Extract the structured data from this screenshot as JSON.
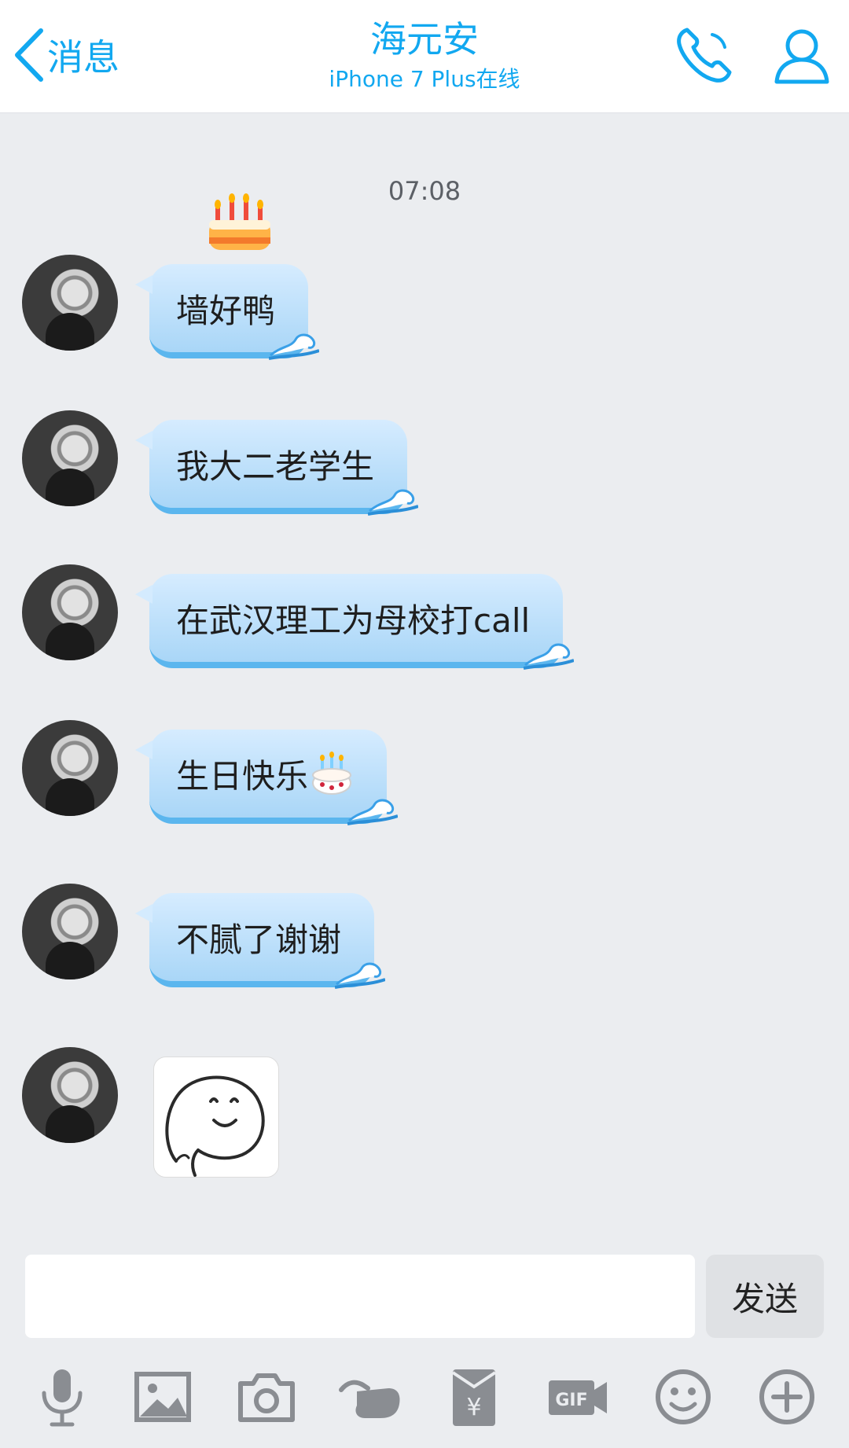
{
  "header": {
    "back_label": "消息",
    "contact_name": "海元安",
    "contact_status": "iPhone 7 Plus在线",
    "call_icon": "phone-icon",
    "profile_icon": "person-icon"
  },
  "chat": {
    "timestamp": "07:08",
    "messages": [
      {
        "text": "墙好鸭"
      },
      {
        "text": "我大二老学生"
      },
      {
        "text": "在武汉理工为母校打call"
      },
      {
        "text": "生日快乐"
      },
      {
        "text": "不腻了谢谢"
      }
    ],
    "sticker": "smiley-face-sticker"
  },
  "input": {
    "value": "",
    "send_label": "发送"
  },
  "toolbar": [
    "microphone-icon",
    "image-icon",
    "camera-icon",
    "poke-hand-icon",
    "red-envelope-icon",
    "gif-icon",
    "emoji-icon",
    "plus-icon"
  ],
  "colors": {
    "accent": "#12a8f0",
    "bubble_top": "#d6ecff",
    "bubble_bottom": "#a9d6f7",
    "background": "#ebedf0"
  }
}
